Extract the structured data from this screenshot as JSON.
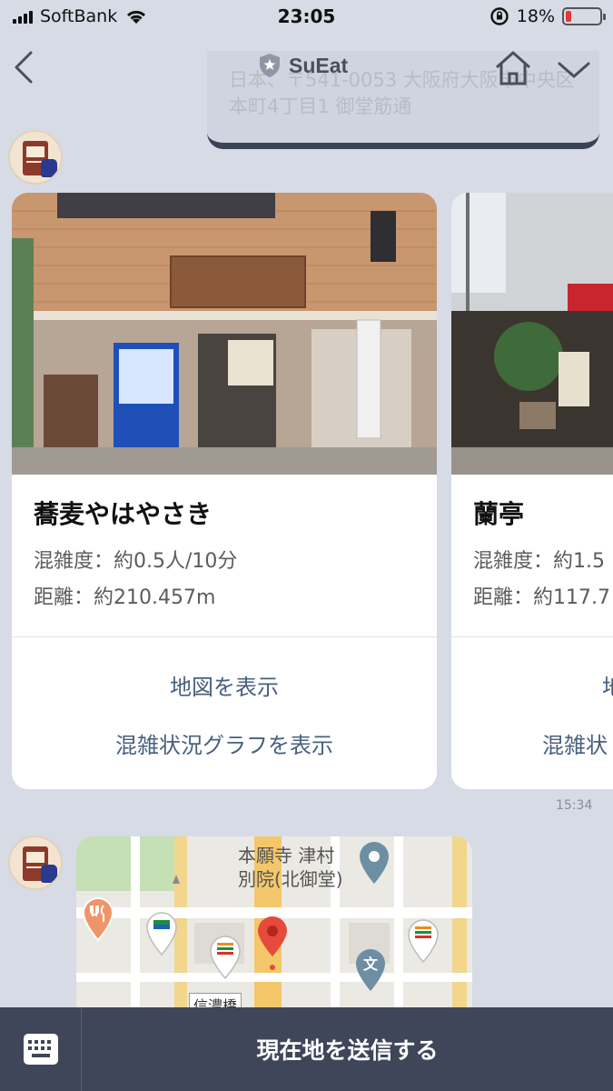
{
  "status_bar": {
    "carrier": "SoftBank",
    "time": "23:05",
    "battery": "18%",
    "battery_level": 0.18
  },
  "header": {
    "title": "SuEat",
    "location_banner": "日本、〒541-0053 大阪府大阪市中央区本町4丁目1 御堂筋通"
  },
  "cards": [
    {
      "name": "蕎麦やはやさき",
      "congestion": "混雑度：約0.5人/10分",
      "distance": "距離：約210.457m",
      "map_action": "地図を表示",
      "graph_action": "混雑状況グラフを表示"
    },
    {
      "name": "蘭亭",
      "congestion": "混雑度：約1.5",
      "distance": "距離：約117.7",
      "map_action": "地",
      "graph_action": "混雑状"
    }
  ],
  "message_time": "15:34",
  "map": {
    "poi_name": "本願寺 津村別院(北御堂)",
    "poi_line1": "本願寺 津村",
    "poi_line2": "別院(北御堂)",
    "street_label": "信濃橋",
    "school_glyph": "文"
  },
  "bottom_bar": {
    "send_location_label": "現在地を送信する"
  },
  "colors": {
    "accent_link": "#48607f",
    "bottom_bar": "#3f4659",
    "background": "#d6dbe6"
  }
}
